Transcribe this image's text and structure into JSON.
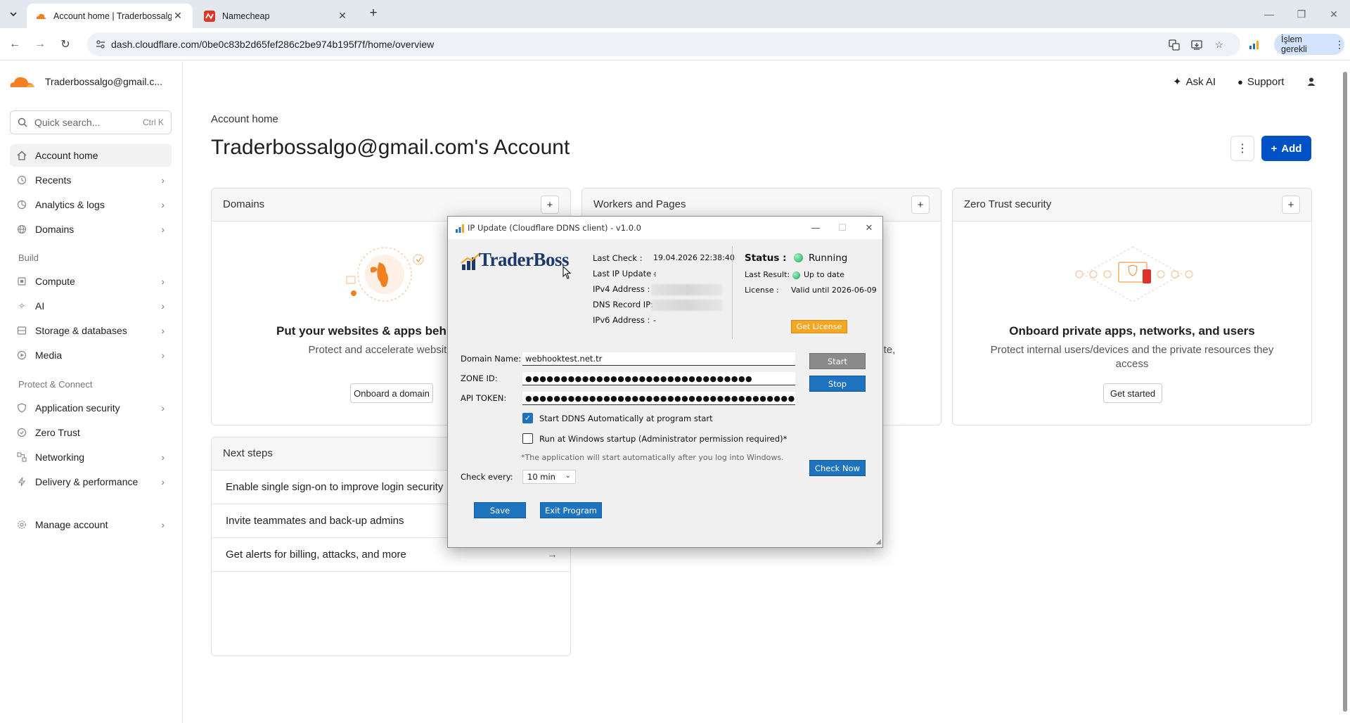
{
  "browser": {
    "tabs": [
      {
        "title": "Account home | Traderbossalgo",
        "active": true
      },
      {
        "title": "Namecheap",
        "active": false
      }
    ],
    "url": "dash.cloudflare.com/0be0c83b2d65fef286c2be974b195f7f/home/overview",
    "profile_button": "İşlem gerekli"
  },
  "sidebar": {
    "account_email": "Traderbossalgo@gmail.c...",
    "search_placeholder": "Quick search...",
    "search_shortcut": "Ctrl K",
    "items_top": [
      {
        "label": "Account home",
        "icon": "home-icon"
      },
      {
        "label": "Recents",
        "icon": "clock-icon"
      },
      {
        "label": "Analytics & logs",
        "icon": "chart-icon"
      },
      {
        "label": "Domains",
        "icon": "globe-icon"
      }
    ],
    "section_build": "Build",
    "items_build": [
      {
        "label": "Compute",
        "icon": "compute-icon"
      },
      {
        "label": "AI",
        "icon": "sparkle-icon"
      },
      {
        "label": "Storage & databases",
        "icon": "database-icon"
      },
      {
        "label": "Media",
        "icon": "media-icon"
      }
    ],
    "section_protect": "Protect & Connect",
    "items_protect": [
      {
        "label": "Application security",
        "icon": "shield-icon"
      },
      {
        "label": "Zero Trust",
        "icon": "shield-check-icon"
      },
      {
        "label": "Networking",
        "icon": "network-icon"
      },
      {
        "label": "Delivery & performance",
        "icon": "bolt-icon"
      }
    ],
    "manage_account": "Manage account"
  },
  "header": {
    "ask_ai": "Ask AI",
    "support": "Support"
  },
  "main": {
    "breadcrumb": "Account home",
    "title": "Traderbossalgo@gmail.com's Account",
    "add_label": "Add",
    "cards": {
      "domains": {
        "title": "Domains",
        "heading": "Put your websites & apps behind",
        "text": "Protect and accelerate websites, apps, and the Internet",
        "button": "Onboard a domain"
      },
      "workers": {
        "title": "Workers and Pages",
        "text_fragment": "oute,"
      },
      "zerotrust": {
        "title": "Zero Trust security",
        "heading": "Onboard private apps, networks, and users",
        "text": "Protect internal users/devices and the private resources they access",
        "button": "Get started"
      }
    },
    "next_steps": {
      "title": "Next steps",
      "items": [
        "Enable single sign-on to improve login security",
        "Invite teammates and back-up admins",
        "Get alerts for billing, attacks, and more"
      ]
    }
  },
  "dialog": {
    "title": "IP Update (Cloudflare DDNS client) - v1.0.0",
    "logo_text": "TraderBoss",
    "info": {
      "last_check_label": "Last Check :",
      "last_check_value": "19.04.2026 22:38:40",
      "last_ip_update_label": "Last IP Update :",
      "last_ip_update_value": "-",
      "ipv4_label": "IPv4 Address :",
      "dns_record_label": "DNS Record IP:",
      "ipv6_label": "IPv6 Address :",
      "ipv6_value": "-"
    },
    "status": {
      "status_label": "Status :",
      "status_value": "Running",
      "last_result_label": "Last Result:",
      "last_result_value": "Up to date",
      "license_label": "License :",
      "license_value": "Valid until 2026-06-09",
      "get_license": "Get License"
    },
    "form": {
      "domain_label": "Domain Name:",
      "domain_value": "webhooktest.net.tr",
      "zone_label": "ZONE ID:",
      "zone_value": "●●●●●●●●●●●●●●●●●●●●●●●●●●●●●●●●",
      "token_label": "API TOKEN:",
      "token_value": "●●●●●●●●●●●●●●●●●●●●●●●●●●●●●●●●●●●●●●●●",
      "start_ddns": "Start DDNS  Automatically at program start",
      "run_startup": "Run at Windows startup (Administrator permission required)*",
      "note": "*The application will start automatically after you log into Windows.",
      "check_every_label": "Check every:",
      "check_every_value": "10 min"
    },
    "buttons": {
      "start": "Start",
      "stop": "Stop",
      "check_now": "Check Now",
      "save": "Save",
      "exit": "Exit Program"
    }
  }
}
